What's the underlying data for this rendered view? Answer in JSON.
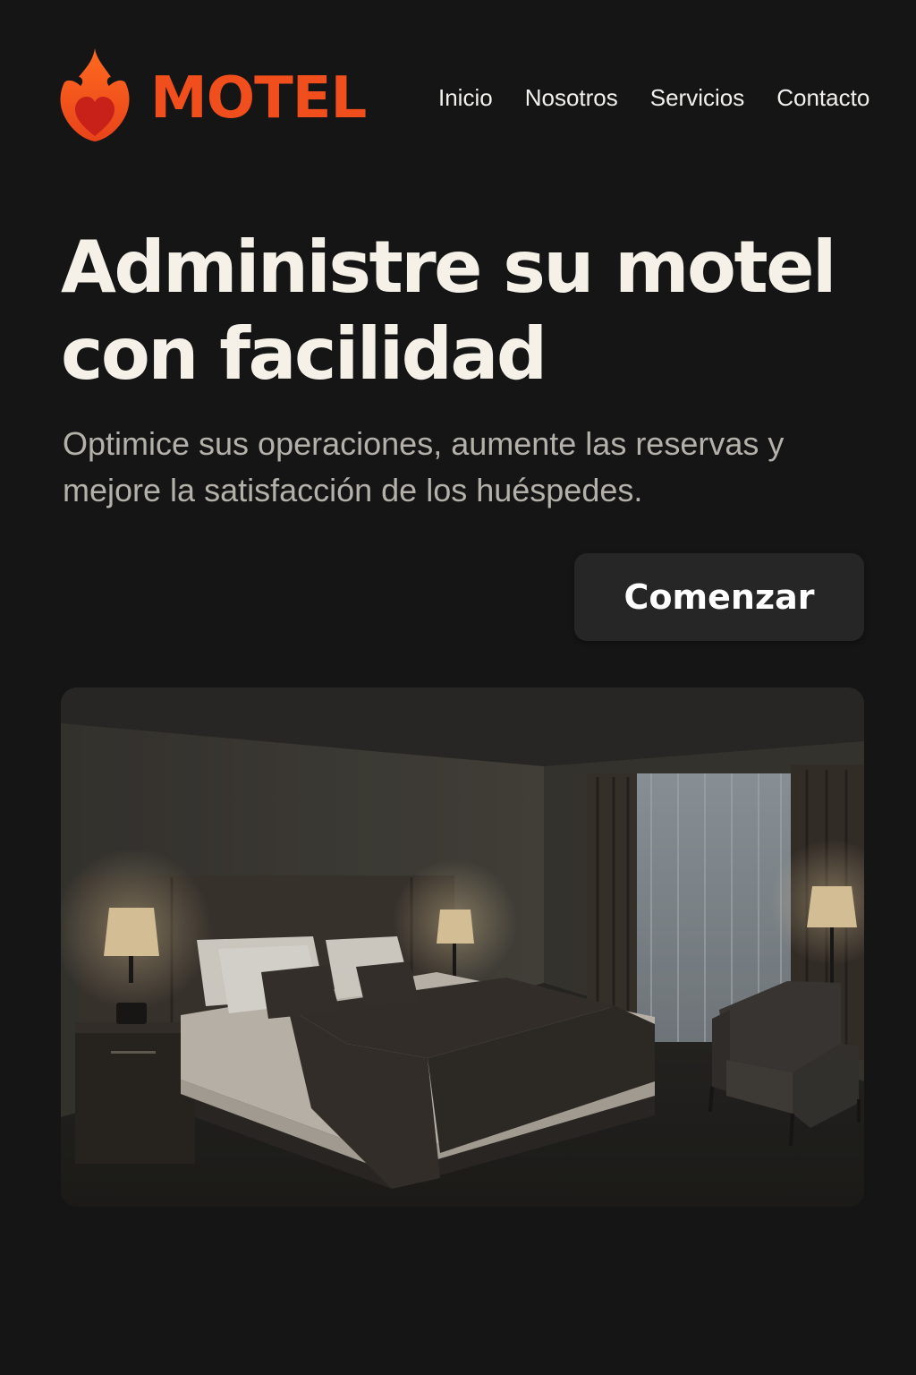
{
  "brand": {
    "name": "MOTEL",
    "icon": "flame-heart-icon",
    "color": "#f04e1c"
  },
  "nav": {
    "items": [
      {
        "label": "Inicio"
      },
      {
        "label": "Nosotros"
      },
      {
        "label": "Servicios"
      },
      {
        "label": "Contacto"
      }
    ]
  },
  "hero": {
    "title": "Administre su motel con facilidad",
    "subtitle": "Optimice sus operaciones, aumente las reservas y mejore la satisfacción de los huéspedes.",
    "cta_label": "Comenzar"
  },
  "image": {
    "subject": "hotel-room-photo"
  },
  "colors": {
    "background": "#151515",
    "title": "#f5f0e8",
    "subtitle": "#b4b0aa",
    "button_bg": "#262626",
    "accent": "#f04e1c"
  }
}
